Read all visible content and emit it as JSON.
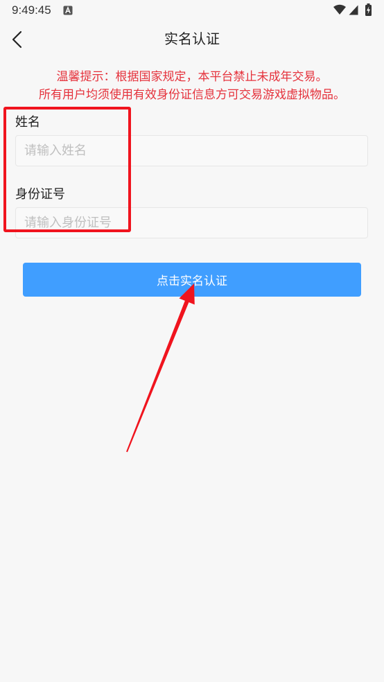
{
  "status_bar": {
    "time": "9:49:45",
    "icons": [
      "a-notification-icon",
      "wifi-icon",
      "signal-icon",
      "battery-charging-icon"
    ]
  },
  "header": {
    "back_icon": "chevron-left-icon",
    "title": "实名认证"
  },
  "notice": {
    "line1": "温馨提示：根据国家规定，本平台禁止未成年交易。",
    "line2": "所有用户均须使用有效身份证信息方可交易游戏虚拟物品。"
  },
  "form": {
    "name": {
      "label": "姓名",
      "placeholder": "请输入姓名",
      "value": ""
    },
    "id_number": {
      "label": "身份证号",
      "placeholder": "请输入身份证号",
      "value": ""
    }
  },
  "submit_label": "点击实名认证",
  "colors": {
    "background": "#f7f7f7",
    "text": "#222222",
    "accent": "#409eff",
    "warning": "#e5323c",
    "placeholder": "#bfbfbf",
    "annotation": "#f0141e"
  }
}
